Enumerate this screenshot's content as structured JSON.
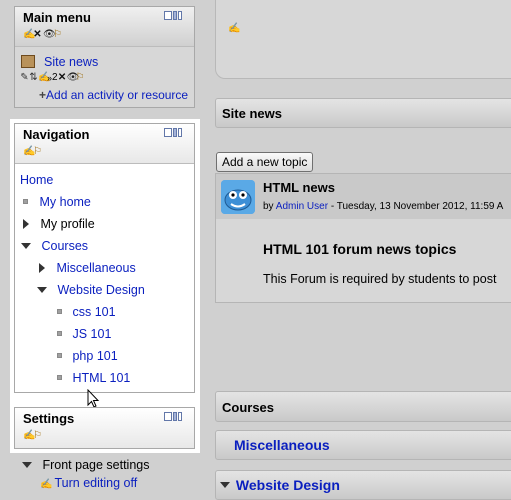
{
  "main_menu": {
    "title": "Main menu",
    "site_news_link": "Site news",
    "move_count": "2",
    "add_activity": "Add an activity or resource"
  },
  "navigation": {
    "title": "Navigation",
    "home": "Home",
    "my_home": "My home",
    "my_profile": "My profile",
    "courses": "Courses",
    "miscellaneous": "Miscellaneous",
    "website_design": "Website Design",
    "course_items": [
      "css 101",
      "JS 101",
      "php 101",
      "HTML 101"
    ]
  },
  "settings": {
    "title": "Settings",
    "front_page_settings": "Front page settings",
    "turn_editing_off": "Turn editing off"
  },
  "site_news": {
    "title": "Site news",
    "add_topic_button": "Add a new topic",
    "post": {
      "subject": "HTML news",
      "by_prefix": "by",
      "author": "Admin User",
      "date": "- Tuesday, 13 November 2012, 11:59 A",
      "heading": "HTML 101 forum news topics",
      "body": "This Forum is required by students to post"
    }
  },
  "courses_section": {
    "title": "Courses",
    "categories": [
      "Miscellaneous",
      "Website Design"
    ]
  },
  "colors": {
    "link": "#0a1fbf",
    "background": "#d0d0d0",
    "highlight": "#ffffff"
  }
}
